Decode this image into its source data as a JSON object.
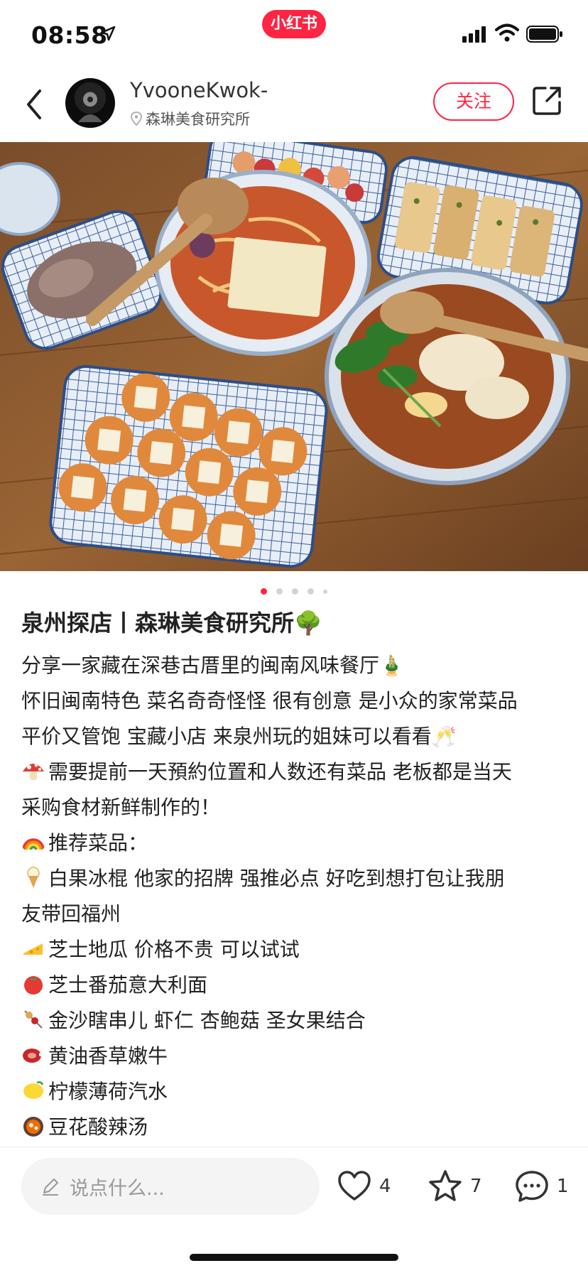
{
  "status_bar": {
    "time": "08:58",
    "app_badge": "小红书",
    "brand_color": "#ff2442"
  },
  "header": {
    "author_name": "YvooneKwok-",
    "location": "森琳美食研究所",
    "follow_label": "关注",
    "icons": [
      "chevron-left-icon",
      "avatar",
      "map-pin-icon",
      "share-icon"
    ]
  },
  "carousel": {
    "image_subject": "food-spread-photo",
    "page_count": 5,
    "current_page": 1
  },
  "post": {
    "title": "泉州探店丨森琳美食研究所🌳",
    "lines": [
      "分享一家藏在深巷古厝里的闽南风味餐厅🎍",
      "怀旧闽南特色 菜名奇奇怪怪 很有创意 是小众的家常菜品",
      "平价又管饱  宝藏小店 来泉州玩的姐妹可以看看🥂",
      "需要提前一天預約位置和人数还有菜品 老板都是当天",
      "采购食材新鲜制作的！",
      "推荐菜品：",
      "白果冰棍 他家的招牌 强推必点 好吃到想打包让我朋",
      "友带回福州",
      "芝士地瓜  价格不贵 可以试试",
      "芝士番茄意大利面",
      "金沙瞎串儿 虾仁 杏鲍菇 圣女果结合",
      "黄油香草嫩牛",
      "柠檬薄荷汽水",
      "豆花酸辣汤"
    ],
    "line_emojis": [
      "",
      "",
      "",
      "mushroom",
      "",
      "rainbow",
      "ice-cream",
      "",
      "cheese",
      "tomato",
      "skewer",
      "meat",
      "lemon",
      "hotpot"
    ]
  },
  "bottom_bar": {
    "comment_placeholder": "说点什么...",
    "likes": "4",
    "collects": "7",
    "comments": "1"
  }
}
